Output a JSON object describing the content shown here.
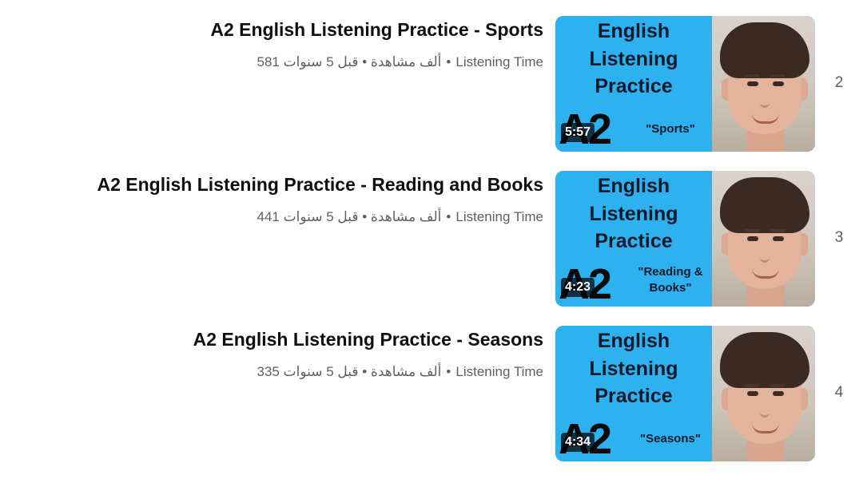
{
  "videos": [
    {
      "index": "2",
      "title": "A2 English Listening Practice - Sports",
      "channel": "Listening Time",
      "views_age": "581 ألف مشاهدة • قبل 5 سنوات",
      "duration": "5:57",
      "thumb_line1": "English",
      "thumb_line2": "Listening",
      "thumb_line3": "Practice",
      "thumb_level": "A2",
      "thumb_topic": "\"Sports\""
    },
    {
      "index": "3",
      "title": "A2 English Listening Practice - Reading and Books",
      "channel": "Listening Time",
      "views_age": "441 ألف مشاهدة • قبل 5 سنوات",
      "duration": "4:23",
      "thumb_line1": "English",
      "thumb_line2": "Listening",
      "thumb_line3": "Practice",
      "thumb_level": "A2",
      "thumb_topic_a": "\"Reading &",
      "thumb_topic_b": "Books\""
    },
    {
      "index": "4",
      "title": "A2 English Listening Practice - Seasons",
      "channel": "Listening Time",
      "views_age": "335 ألف مشاهدة • قبل 5 سنوات",
      "duration": "4:34",
      "thumb_line1": "English",
      "thumb_line2": "Listening",
      "thumb_line3": "Practice",
      "thumb_level": "A2",
      "thumb_topic": "\"Seasons\""
    }
  ],
  "colors": {
    "thumb_blue": "#2db2ef",
    "title_text": "#0f0f0f",
    "meta_text": "#606060"
  }
}
